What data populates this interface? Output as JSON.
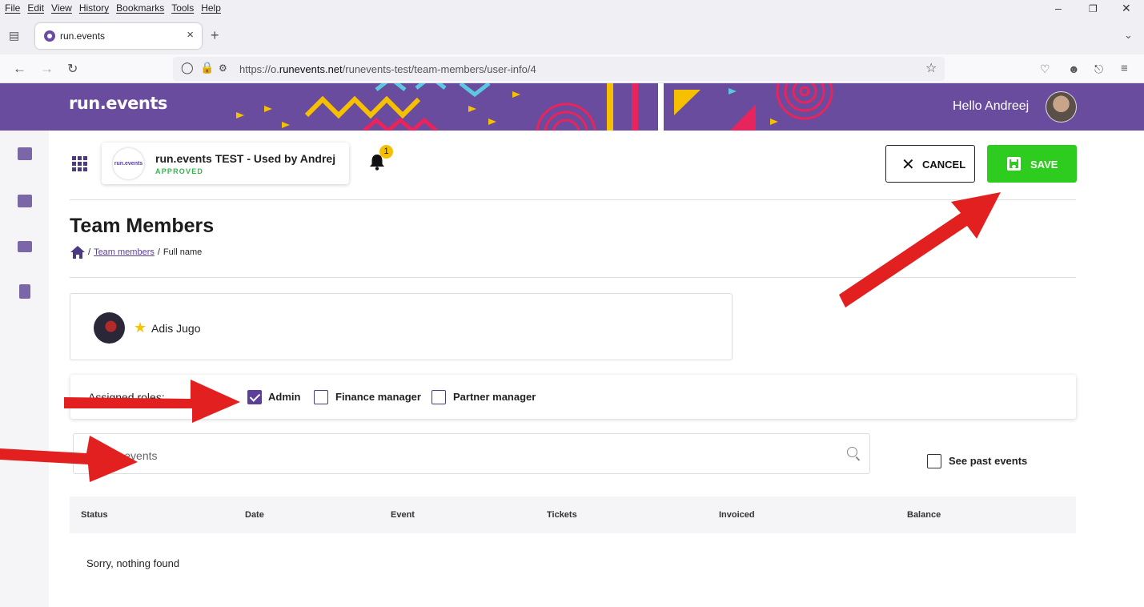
{
  "browser": {
    "menu": [
      "File",
      "Edit",
      "View",
      "History",
      "Bookmarks",
      "Tools",
      "Help"
    ],
    "tab_title": "run.events",
    "url_prefix": "https://o.",
    "url_domain": "runevents.net",
    "url_path": "/runevents-test/team-members/user-info/4"
  },
  "header": {
    "logo_text": "run.events",
    "greeting": "Hello Andreej"
  },
  "org": {
    "logo_text": "run.events",
    "name": "run.events TEST - Used by Andrej",
    "status": "APPROVED",
    "notifications": "1"
  },
  "actions": {
    "cancel_label": "CANCEL",
    "save_label": "SAVE"
  },
  "page": {
    "title": "Team Members",
    "breadcrumb": [
      "Team members",
      "Full name"
    ]
  },
  "user": {
    "name": "Adis Jugo"
  },
  "roles": {
    "label": "Assigned roles:",
    "options": [
      {
        "label": "Admin",
        "checked": true
      },
      {
        "label": "Finance manager",
        "checked": false
      },
      {
        "label": "Partner manager",
        "checked": false
      }
    ]
  },
  "search": {
    "placeholder": "Search events",
    "past_events_label": "See past events"
  },
  "table": {
    "columns": [
      "Status",
      "Date",
      "Event",
      "Tickets",
      "Invoiced",
      "Balance"
    ],
    "empty_message": "Sorry, nothing found"
  },
  "colors": {
    "brand_purple": "#6a4c9f",
    "save_green": "#2ecc1f",
    "approved_green": "#2cb84a",
    "arrow_red": "#e32020"
  }
}
